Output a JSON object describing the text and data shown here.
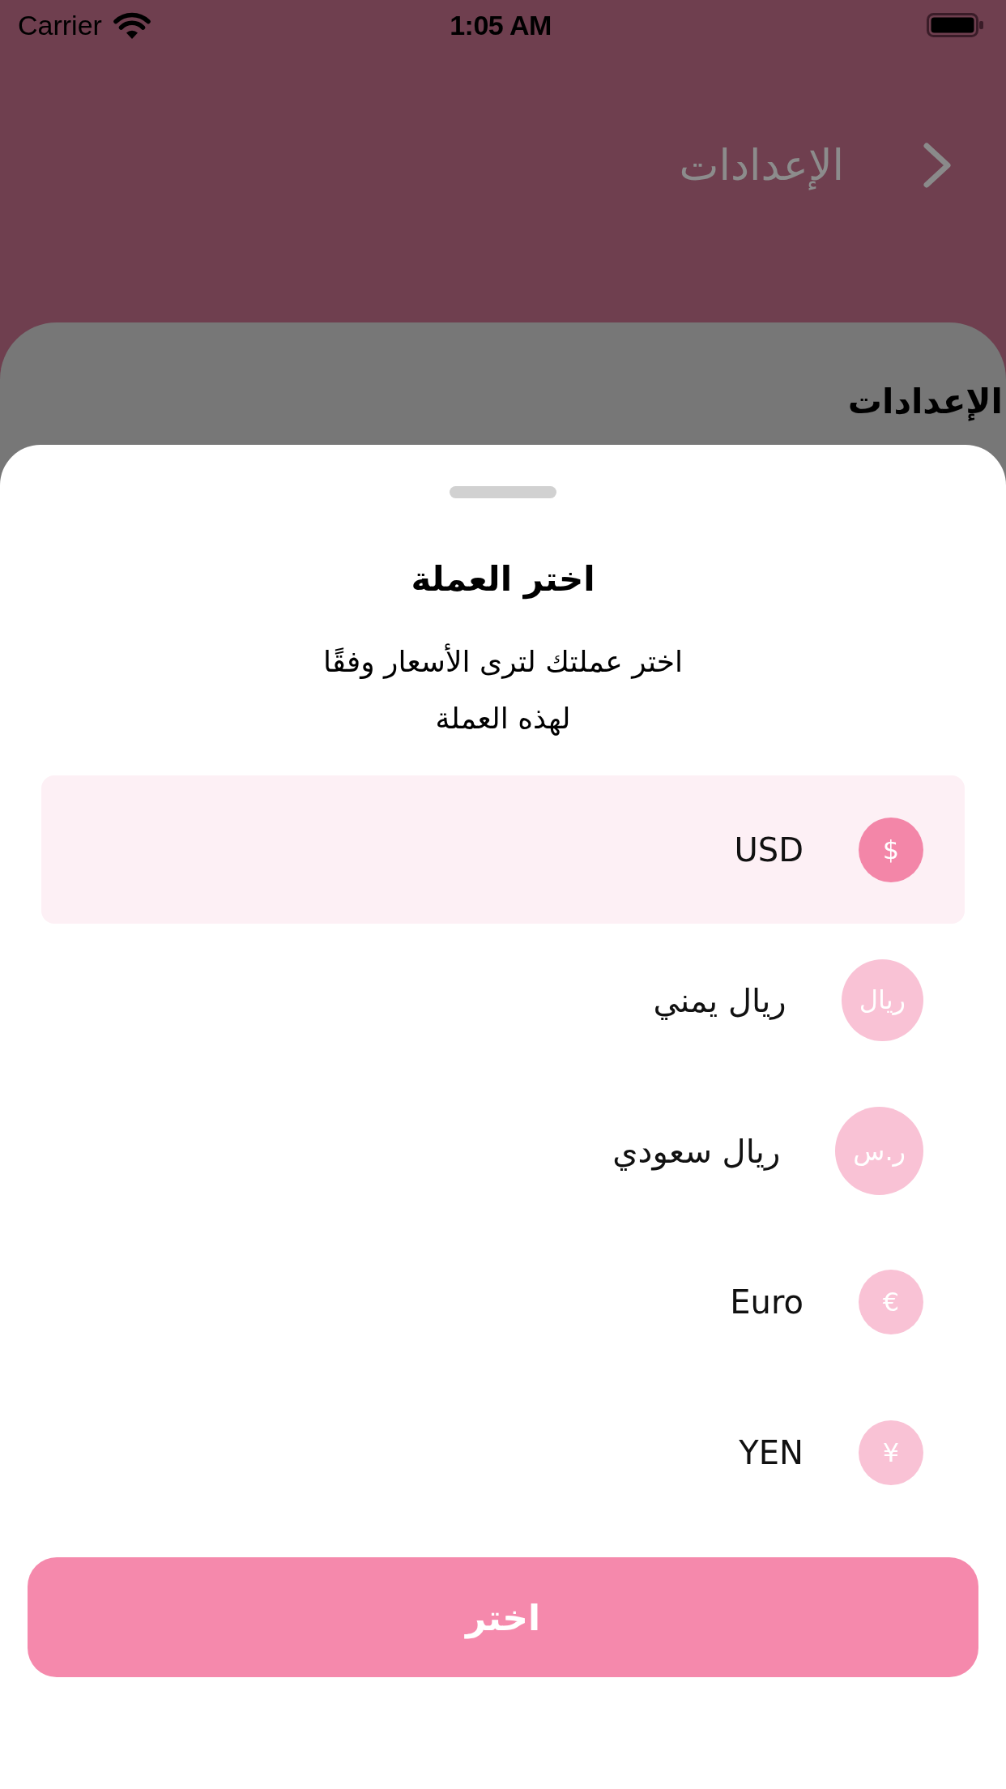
{
  "status_bar": {
    "carrier": "Carrier",
    "time": "1:05 AM"
  },
  "nav_bar": {
    "title": "الإعدادات"
  },
  "page": {
    "title": "الإعدادات"
  },
  "currency_sheet": {
    "title": "اختر العملة",
    "subtitle": "اختر عملتك لترى الأسعار وفقًا لهذه العملة",
    "currencies": [
      {
        "symbol": "$",
        "name": "USD",
        "selected": true
      },
      {
        "symbol": "ريال",
        "name": "ريال يمني",
        "selected": false
      },
      {
        "symbol": "ر.س",
        "name": "ريال سعودي",
        "selected": false
      },
      {
        "symbol": "€",
        "name": "Euro",
        "selected": false
      },
      {
        "symbol": "¥",
        "name": "YEN",
        "selected": false
      }
    ],
    "button": "اختر"
  }
}
